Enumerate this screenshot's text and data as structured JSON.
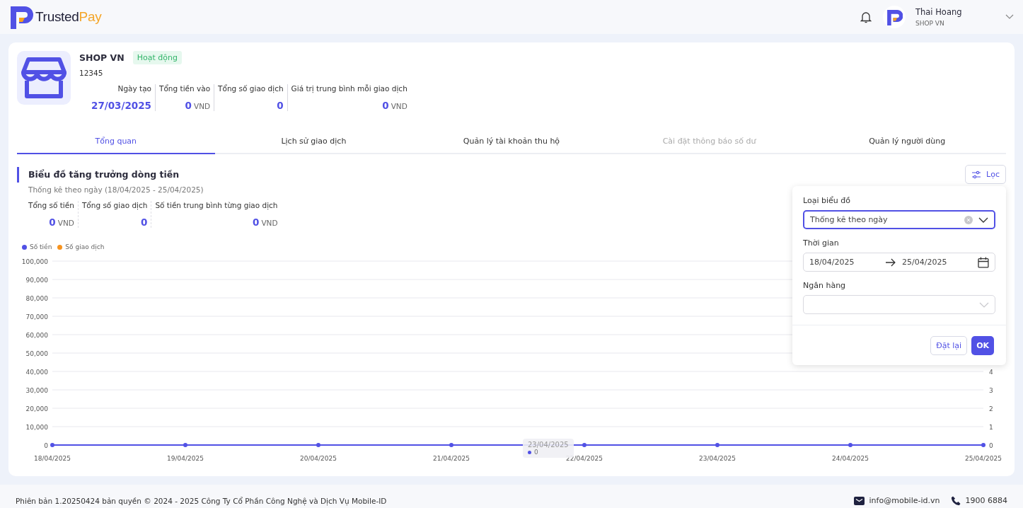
{
  "header": {
    "logo": {
      "primary": "Trusted",
      "accent": "Pay"
    },
    "user": {
      "name": "Thai Hoang",
      "shop": "SHOP VN"
    }
  },
  "shop": {
    "name": "SHOP VN",
    "status": "Hoạt động",
    "active": true,
    "id": "12345",
    "stats": [
      {
        "label": "Ngày tạo",
        "value": "27/03/2025"
      },
      {
        "label": "Tổng tiền vào",
        "value": "0",
        "unit": "VND"
      },
      {
        "label": "Tổng số giao dịch",
        "value": "0"
      },
      {
        "label": "Giá trị trung bình mỗi giao dịch",
        "value": "0",
        "unit": "VND"
      }
    ]
  },
  "tabs": [
    {
      "label": "Tổng quan",
      "selected": true,
      "disabled": false
    },
    {
      "label": "Lịch sử giao dịch",
      "selected": false,
      "disabled": false
    },
    {
      "label": "Quản lý tài khoản thu hộ",
      "selected": false,
      "disabled": false
    },
    {
      "label": "Cài đặt thông báo số dư",
      "selected": false,
      "disabled": true
    },
    {
      "label": "Quản lý người dùng",
      "selected": false,
      "disabled": false
    }
  ],
  "chart_section": {
    "title": "Biểu đồ tăng trưởng dòng tiền",
    "subtitle": "Thống kê theo ngày (18/04/2025 - 25/04/2025)",
    "filter_button": "Lọc",
    "stats": [
      {
        "label": "Tổng số tiền",
        "value": "0",
        "unit": "VND"
      },
      {
        "label": "Tổng số giao dịch",
        "value": "0"
      },
      {
        "label": "Số tiền trung bình từng giao dịch",
        "value": "0",
        "unit": "VND"
      }
    ],
    "tooltip": {
      "date": "23/04/2025",
      "value": "0"
    },
    "chart_data": {
      "type": "line",
      "categories": [
        "18/04/2025",
        "19/04/2025",
        "20/04/2025",
        "21/04/2025",
        "22/04/2025",
        "23/04/2025",
        "24/04/2025",
        "25/04/2025"
      ],
      "series": [
        {
          "name": "Số tiền",
          "color": "#5151e5",
          "marker": "circle",
          "values": [
            0,
            0,
            0,
            0,
            0,
            0,
            0,
            0
          ]
        },
        {
          "name": "Số giao dịch",
          "color": "#f7931e",
          "marker": "circle",
          "values": [
            null,
            null,
            null,
            null,
            null,
            null,
            null,
            null
          ]
        }
      ],
      "legend": true,
      "grid": true,
      "ylim": [
        0,
        100000
      ],
      "yticks": [
        {
          "value": 0,
          "label": "0"
        },
        {
          "value": 10000,
          "label": "10,000"
        },
        {
          "value": 20000,
          "label": "20,000"
        },
        {
          "value": 30000,
          "label": "30,000"
        },
        {
          "value": 40000,
          "label": "40,000"
        },
        {
          "value": 50000,
          "label": "50,000"
        },
        {
          "value": 60000,
          "label": "60,000"
        },
        {
          "value": 70000,
          "label": "70,000"
        },
        {
          "value": 80000,
          "label": "80,000"
        },
        {
          "value": 90000,
          "label": "90,000"
        },
        {
          "value": 100000,
          "label": "100,000"
        }
      ],
      "y2lim": [
        0,
        10
      ],
      "y2ticks": [
        0,
        1,
        2,
        3,
        4
      ]
    }
  },
  "filter_panel": {
    "chart_type": {
      "label": "Loại biểu đồ",
      "value": "Thống kê theo ngày"
    },
    "time": {
      "label": "Thời gian",
      "from": "18/04/2025",
      "to": "25/04/2025"
    },
    "bank": {
      "label": "Ngân hàng"
    },
    "buttons": [
      {
        "label": "Đặt lại",
        "kind": "secondary"
      },
      {
        "label": "OK",
        "kind": "primary"
      }
    ]
  },
  "footer": {
    "copyright": "Phiên bản 1.20250424 bản quyền © 2024 - 2025 Công Ty Cổ Phần Công Nghệ và Dịch Vụ Mobile-ID",
    "email": "info@mobile-id.vn",
    "phone": "1900 6884"
  }
}
